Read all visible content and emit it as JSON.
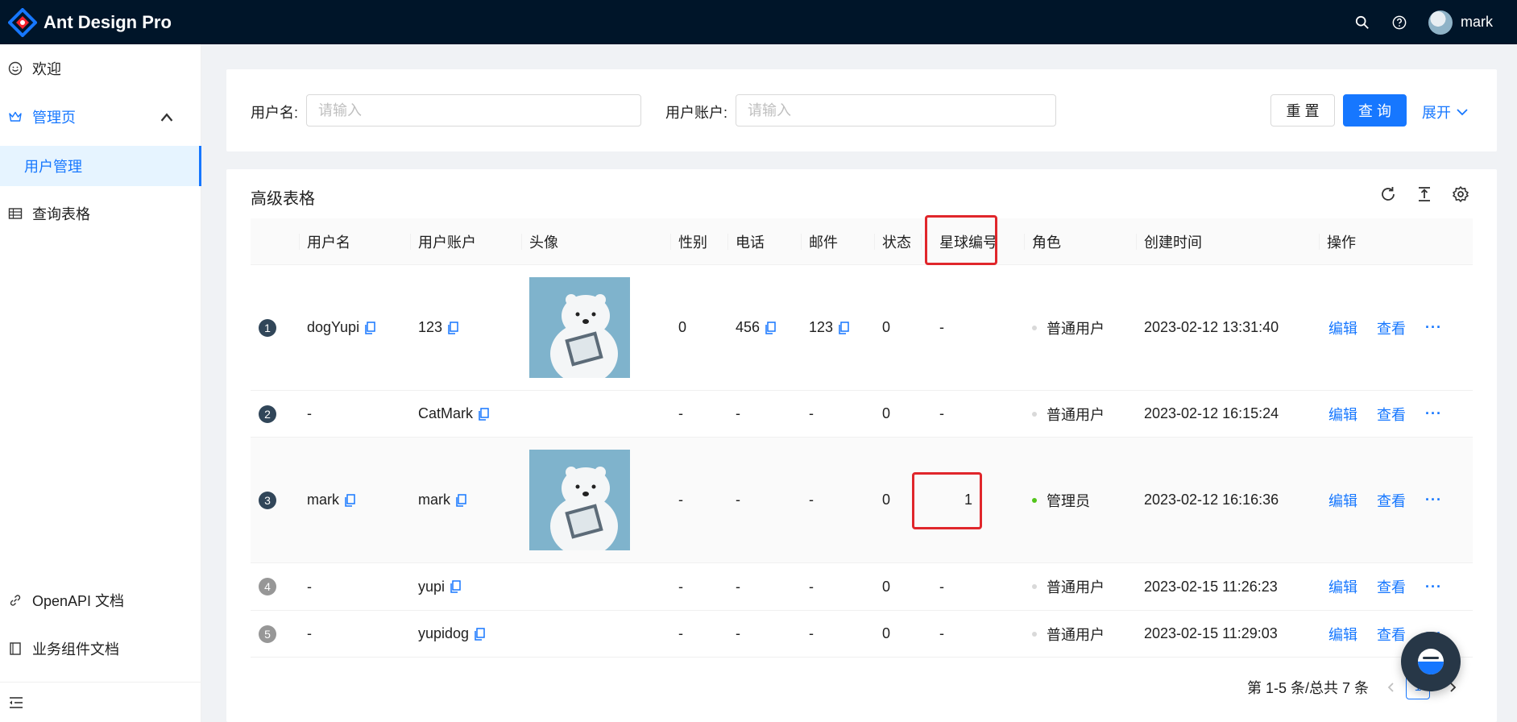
{
  "app": {
    "title": "Ant Design Pro",
    "user_name": "mark"
  },
  "colors": {
    "primary": "#1677ff",
    "header_bg": "#001529",
    "highlight_box": "#e0262b",
    "success": "#52c41a",
    "default_dot": "#d9d9d9"
  },
  "header": {
    "icons": [
      "search-icon",
      "question-circle-icon"
    ]
  },
  "sidebar": {
    "items": [
      {
        "label": "欢迎",
        "icon": "smile-icon"
      },
      {
        "label": "管理页",
        "icon": "crown-icon"
      },
      {
        "label": "用户管理"
      },
      {
        "label": "查询表格",
        "icon": "table-icon"
      },
      {
        "label": "OpenAPI 文档",
        "icon": "link-icon"
      },
      {
        "label": "业务组件文档",
        "icon": "book-icon"
      }
    ],
    "collapse_icon": "menu-fold-icon"
  },
  "search": {
    "fields": [
      {
        "label": "用户名:",
        "placeholder": "请输入"
      },
      {
        "label": "用户账户:",
        "placeholder": "请输入"
      }
    ],
    "reset_label": "重 置",
    "query_label": "查 询",
    "expand_label": "展开"
  },
  "table": {
    "title": "高级表格",
    "toolbar": [
      "reload-icon",
      "density-icon",
      "setting-icon"
    ],
    "columns": [
      "用户名",
      "用户账户",
      "头像",
      "性别",
      "电话",
      "邮件",
      "状态",
      "星球编号",
      "角色",
      "创建时间",
      "操作"
    ],
    "rows": [
      {
        "index": "1",
        "username": "dogYupi",
        "account": "123",
        "has_avatar": true,
        "gender": "0",
        "phone": "456",
        "email": "123",
        "status": "0",
        "planet": "-",
        "role": "普通用户",
        "role_type": "default",
        "created": "2023-02-12 13:31:40"
      },
      {
        "index": "2",
        "username": "-",
        "account": "CatMark",
        "has_avatar": false,
        "gender": "-",
        "phone": "-",
        "email": "-",
        "status": "0",
        "planet": "-",
        "role": "普通用户",
        "role_type": "default",
        "created": "2023-02-12 16:15:24"
      },
      {
        "index": "3",
        "username": "mark",
        "account": "mark",
        "has_avatar": true,
        "gender": "-",
        "phone": "-",
        "email": "-",
        "status": "0",
        "planet": "1",
        "role": "管理员",
        "role_type": "success",
        "created": "2023-02-12 16:16:36"
      },
      {
        "index": "4",
        "username": "-",
        "account": "yupi",
        "has_avatar": false,
        "gender": "-",
        "phone": "-",
        "email": "-",
        "status": "0",
        "planet": "-",
        "role": "普通用户",
        "role_type": "default",
        "created": "2023-02-15 11:26:23"
      },
      {
        "index": "5",
        "username": "-",
        "account": "yupidog",
        "has_avatar": false,
        "gender": "-",
        "phone": "-",
        "email": "-",
        "status": "0",
        "planet": "-",
        "role": "普通用户",
        "role_type": "default",
        "created": "2023-02-15 11:29:03"
      }
    ],
    "actions": {
      "edit": "编辑",
      "view": "查看",
      "more": "···"
    },
    "pagination": {
      "total_text": "第 1-5 条/总共 7 条",
      "current_page": "1"
    }
  }
}
